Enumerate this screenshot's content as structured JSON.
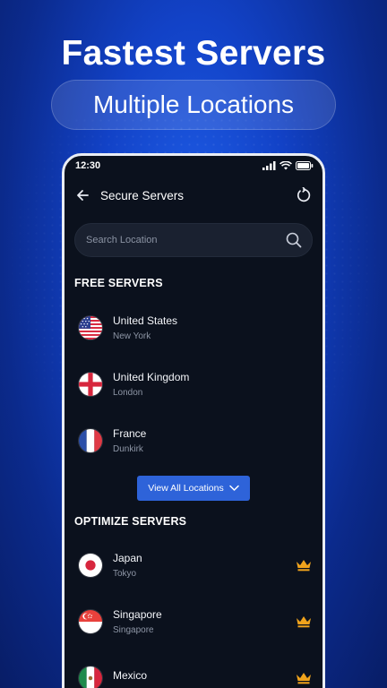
{
  "promo": {
    "headline": "Fastest Servers",
    "subheadline": "Multiple Locations"
  },
  "status_bar": {
    "time": "12:30"
  },
  "header": {
    "title": "Secure Servers"
  },
  "search": {
    "placeholder": "Search Location"
  },
  "free_section": {
    "title": "FREE SERVERS",
    "servers": [
      {
        "country": "United States",
        "city": "New York",
        "flag": "us-flag-icon"
      },
      {
        "country": "United Kingdom",
        "city": "London",
        "flag": "england-flag-icon"
      },
      {
        "country": "France",
        "city": "Dunkirk",
        "flag": "france-flag-icon"
      }
    ]
  },
  "view_all_label": "View All Locations",
  "optimize_section": {
    "title": "OPTIMIZE SERVERS",
    "servers": [
      {
        "country": "Japan",
        "city": "Tokyo",
        "flag": "japan-flag-icon",
        "premium_icon": "crown-icon"
      },
      {
        "country": "Singapore",
        "city": "Singapore",
        "flag": "singapore-flag-icon",
        "premium_icon": "crown-icon"
      },
      {
        "country": "Mexico",
        "city": "",
        "flag": "mexico-flag-icon",
        "premium_icon": "crown-icon"
      }
    ]
  },
  "colors": {
    "accent": "#2e63d9",
    "crown": "#f0a31c",
    "background": "#0b111d"
  }
}
